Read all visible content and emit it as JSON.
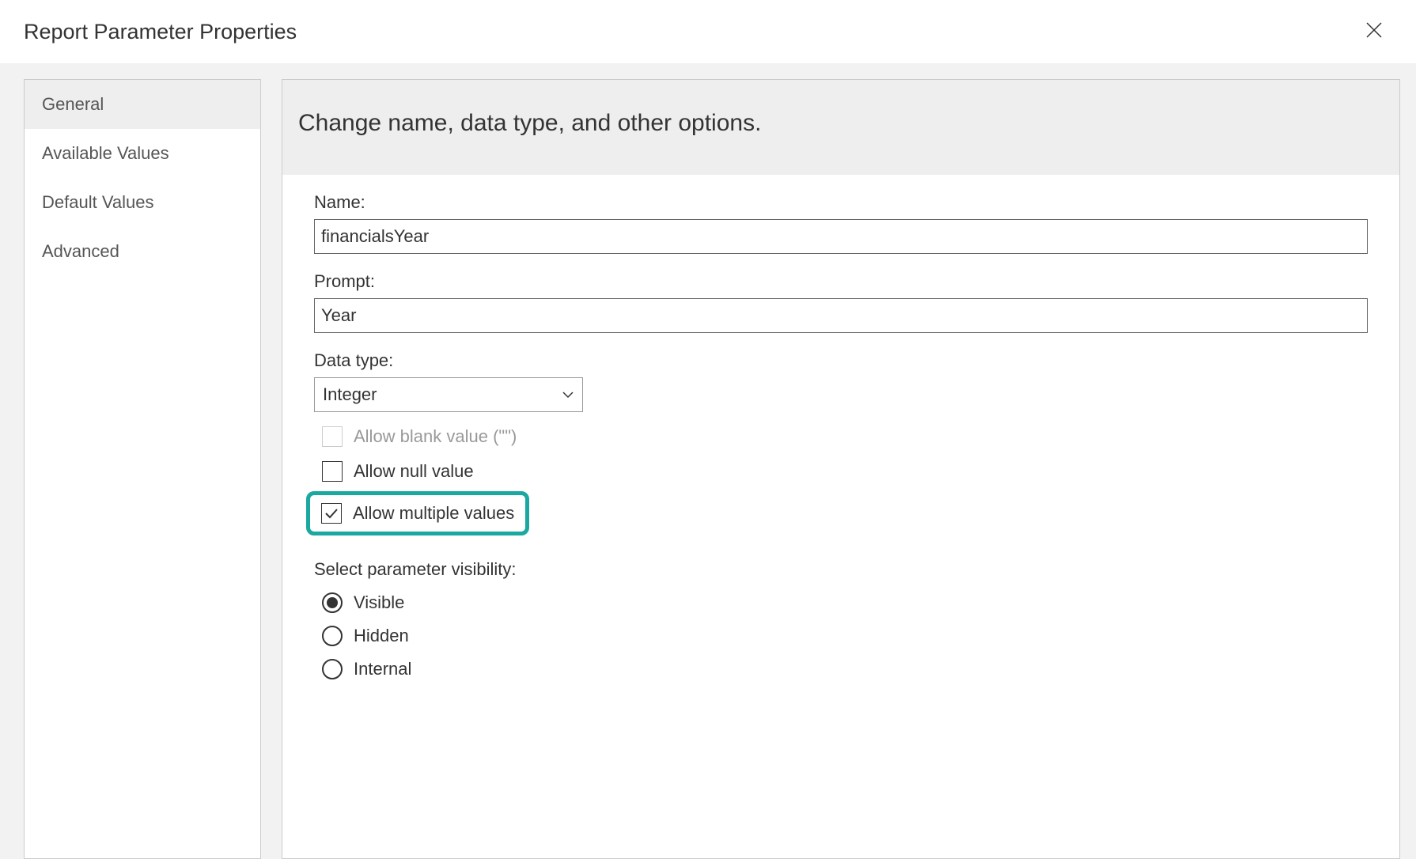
{
  "dialog": {
    "title": "Report Parameter Properties"
  },
  "sidebar": {
    "items": [
      {
        "label": "General",
        "active": true
      },
      {
        "label": "Available Values",
        "active": false
      },
      {
        "label": "Default Values",
        "active": false
      },
      {
        "label": "Advanced",
        "active": false
      }
    ]
  },
  "panel": {
    "header": "Change name, data type, and other options.",
    "name_label": "Name:",
    "name_value": "financialsYear",
    "prompt_label": "Prompt:",
    "prompt_value": "Year",
    "datatype_label": "Data type:",
    "datatype_value": "Integer",
    "checkbox_blank": "Allow blank value (\"\")",
    "checkbox_null": "Allow null value",
    "checkbox_multiple": "Allow multiple values",
    "visibility_label": "Select parameter visibility:",
    "radio_visible": "Visible",
    "radio_hidden": "Hidden",
    "radio_internal": "Internal"
  }
}
